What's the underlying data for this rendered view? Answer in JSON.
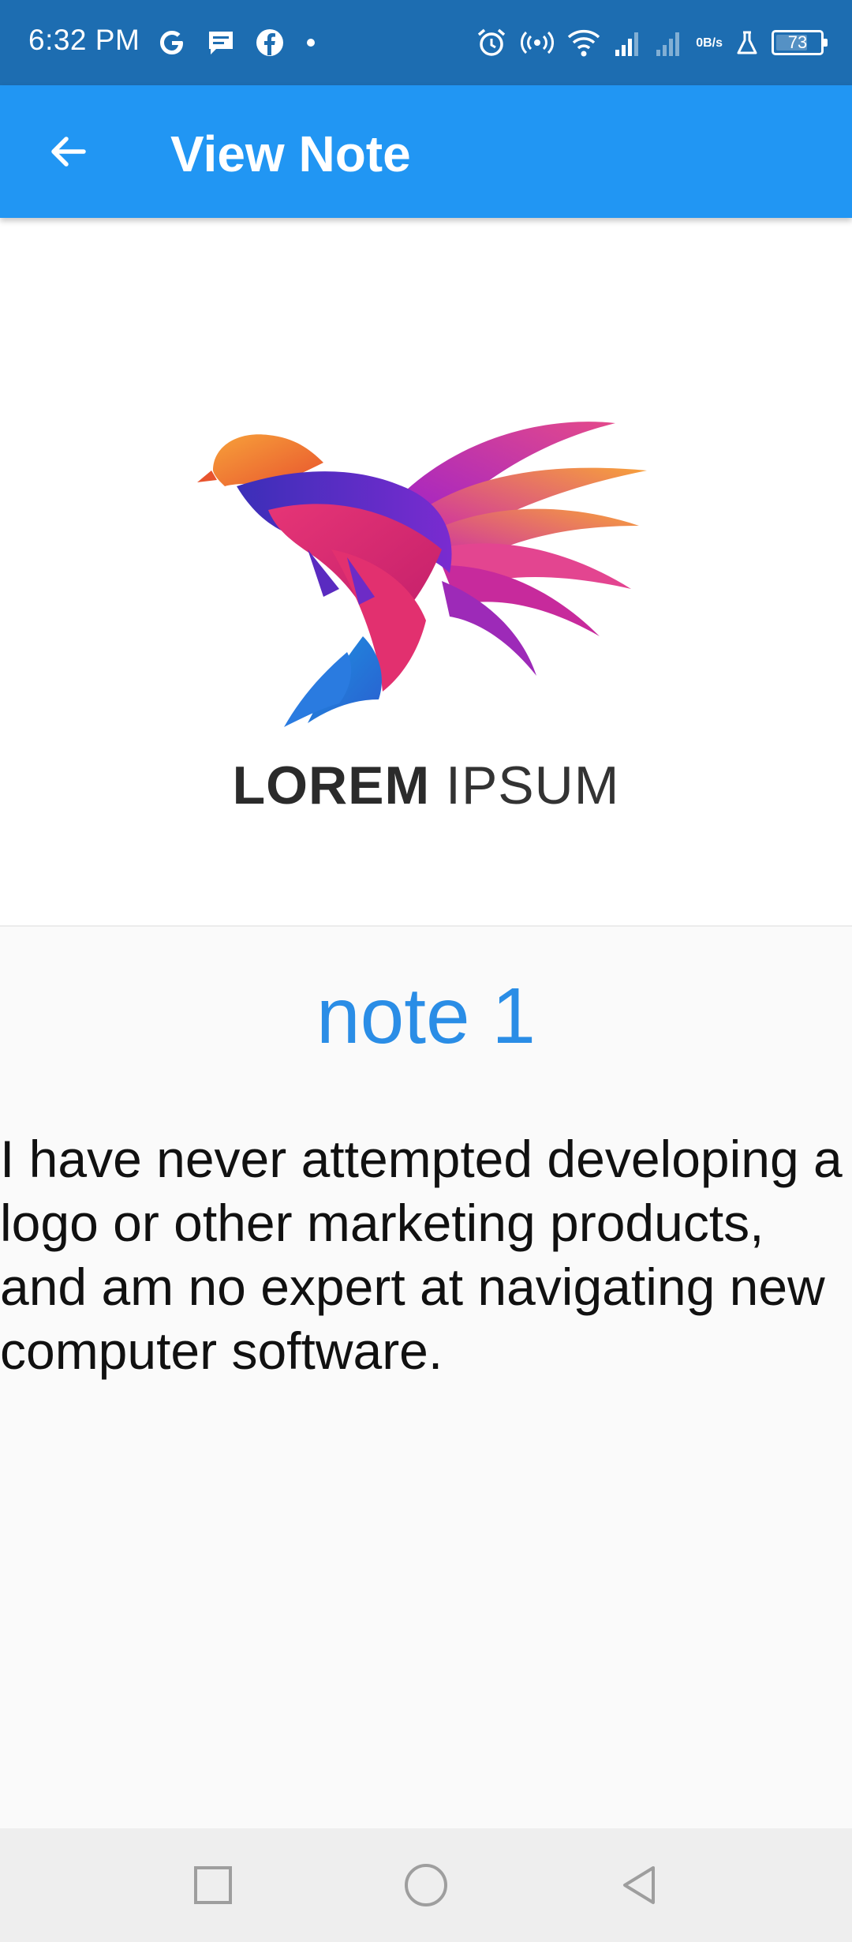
{
  "status_bar": {
    "time": "6:32 PM",
    "left_icons": [
      "google-icon",
      "message-icon",
      "facebook-icon",
      "dot-icon"
    ],
    "right_icons": [
      "alarm-icon",
      "hotspot-icon",
      "wifi-icon",
      "signal-icon",
      "signal-icon",
      "flask-icon"
    ],
    "net_speed_value": "0",
    "net_speed_unit": "B/s",
    "battery_level": "73",
    "battery_fraction": 0.73
  },
  "app_bar": {
    "back_icon": "arrow-back-icon",
    "title": "View Note",
    "color": "#2196f3"
  },
  "note": {
    "image": {
      "logo_word_bold": "LOREM",
      "logo_word_light": "IPSUM"
    },
    "title": "note 1",
    "title_color": "#2a8de6",
    "body": "I have never attempted developing a logo or other marketing products, and am no expert at navigating new computer software."
  },
  "nav_bar": {
    "buttons": [
      "recents-square-icon",
      "home-circle-icon",
      "back-triangle-icon"
    ]
  }
}
